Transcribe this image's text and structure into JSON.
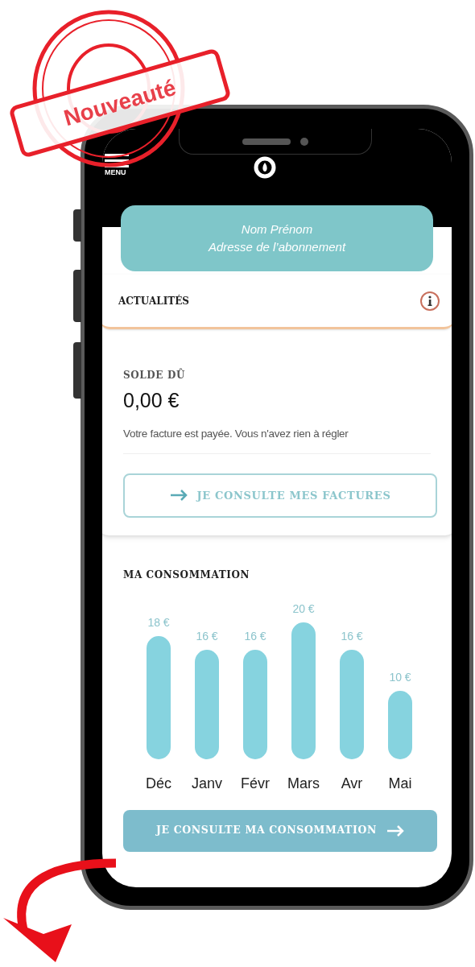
{
  "stamp": {
    "label": "Nouveauté"
  },
  "header": {
    "menu_label": "MENU"
  },
  "account": {
    "name": "Nom Prénom",
    "address": "Adresse de l’abonnement"
  },
  "news": {
    "title": "ACTUALITÉS"
  },
  "balance": {
    "label": "SOLDE DÛ",
    "amount": "0,00 €",
    "message": "Votre facture est payée. Vous n'avez rien à régler",
    "button": "JE CONSULTE MES FACTURES"
  },
  "consumption": {
    "title": "MA CONSOMMATION",
    "chart_data": {
      "type": "bar",
      "categories": [
        "Déc",
        "Janv",
        "Févr",
        "Mars",
        "Avr",
        "Mai"
      ],
      "values": [
        18,
        16,
        16,
        20,
        16,
        10
      ],
      "value_labels": [
        "18 €",
        "16 €",
        "16 €",
        "20 €",
        "16 €",
        "10 €"
      ]
    },
    "button": "JE CONSULTE MA CONSOMMATION"
  }
}
